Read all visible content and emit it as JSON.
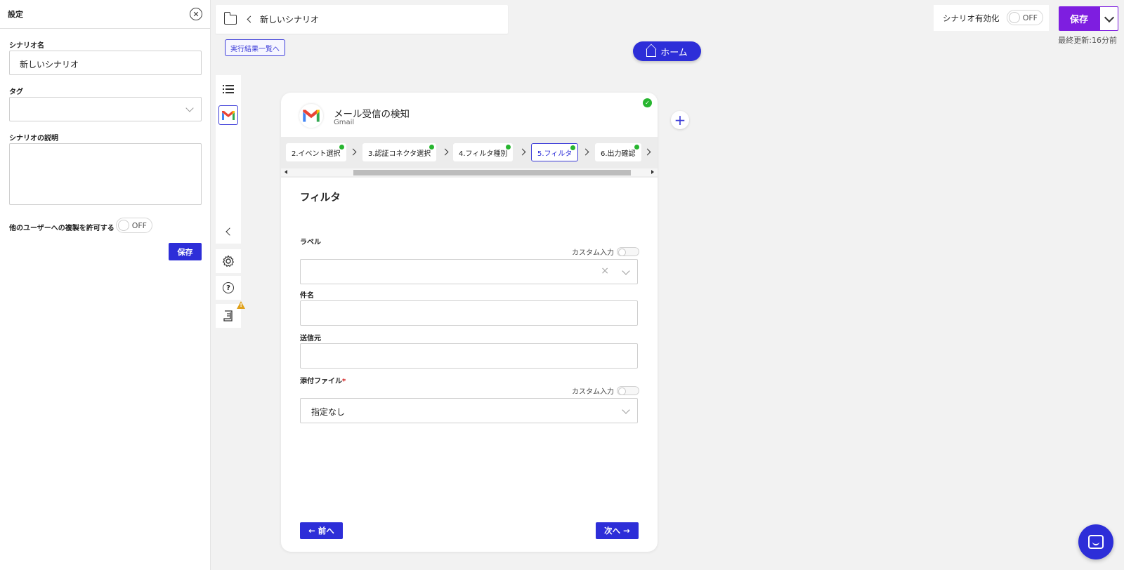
{
  "settings": {
    "title": "設定",
    "close_symbol": "✕",
    "scenario_name_label": "シナリオ名",
    "scenario_name_value": "新しいシナリオ",
    "tag_label": "タグ",
    "description_label": "シナリオの説明",
    "allow_copy_label": "他のユーザーへの複製を許可する",
    "allow_copy_toggle": "OFF",
    "save_label": "保存"
  },
  "header": {
    "breadcrumb_title": "新しいシナリオ",
    "results_link": "実行結果一覧へ",
    "home_label": "ホーム",
    "enable_label": "シナリオ有効化",
    "enable_toggle": "OFF",
    "save_label": "保存",
    "last_updated": "最終更新:16分前"
  },
  "rail": {
    "help_symbol": "?",
    "warning_symbol": "!"
  },
  "card": {
    "title": "メール受信の検知",
    "subtitle": "Gmail",
    "done_symbol": "✓",
    "steps": [
      {
        "label": "2.イベント選択",
        "done": true
      },
      {
        "label": "3.認証コネクタ選択",
        "done": true
      },
      {
        "label": "4.フィルタ種別",
        "done": true
      },
      {
        "label": "5.フィルタ",
        "done": true,
        "active": true
      },
      {
        "label": "6.出力確認",
        "done": true
      }
    ],
    "section_title": "フィルタ",
    "custom_input_label": "カスタム入力",
    "fields": {
      "label": {
        "label": "ラベル",
        "value": "",
        "clear_symbol": "×"
      },
      "subject": {
        "label": "件名",
        "value": ""
      },
      "sender": {
        "label": "送信元",
        "value": ""
      },
      "attachment": {
        "label": "添付ファイル",
        "required_mark": "*",
        "value": "指定なし"
      }
    },
    "prev_label": "← 前へ",
    "next_label": "次へ →"
  },
  "canvas": {
    "plus_symbol": "+"
  },
  "colors": {
    "primary": "#2d2ed8",
    "save_purple": "#7e1ee0",
    "success": "#27b52f",
    "warning": "#e0a11b",
    "required": "#d01a1a"
  },
  "icons": [
    "close-icon",
    "folder-icon",
    "chevron-left-icon",
    "home-icon",
    "chevron-down-icon",
    "list-icon",
    "gmail-icon",
    "gear-icon",
    "help-icon",
    "log-icon",
    "warning-icon",
    "check-icon",
    "plus-icon",
    "chat-icon"
  ]
}
